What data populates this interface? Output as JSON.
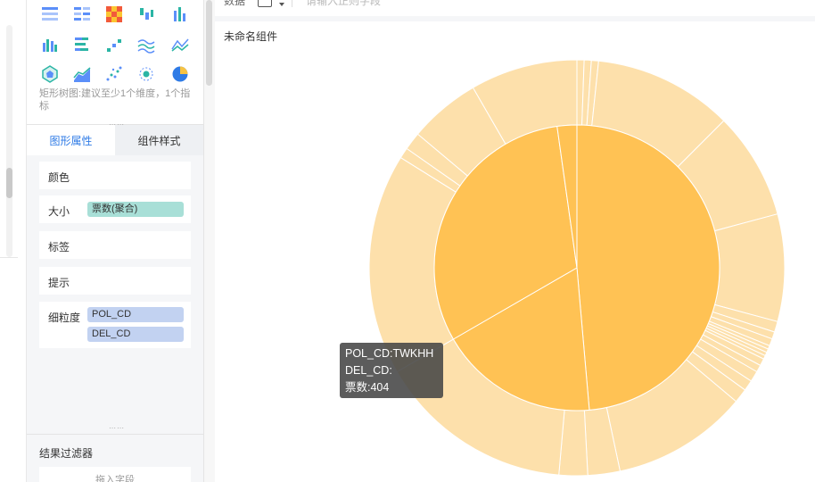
{
  "panel": {
    "chart_hint": "矩形树图:建议至少1个维度，1个指标",
    "tabs": [
      {
        "label": "图形属性",
        "active": true
      },
      {
        "label": "组件样式",
        "active": false
      }
    ],
    "props": {
      "color_label": "颜色",
      "size_label": "大小",
      "size_field": "票数(聚合)",
      "tag_label": "标签",
      "tip_label": "提示",
      "detail_label": "细粒度",
      "detail_fields": [
        "POL_CD",
        "DEL_CD"
      ]
    },
    "filter": {
      "title": "结果过滤器",
      "placeholder": "拖入字段"
    }
  },
  "main": {
    "topbar": {
      "label": "数据",
      "search_placeholder": "请输入正则字段"
    },
    "widget_title": "未命名组件"
  },
  "tooltip": {
    "line1": "POL_CD:TWKHH",
    "line2": "DEL_CD:",
    "line3": "票数:404"
  },
  "colors": {
    "inner_ring": "#ffc254",
    "outer_ring": "#fde0ab",
    "accent": "#2f7be6",
    "teal_pill": "#a8dfd7",
    "blue_pill": "#c2d2f1"
  },
  "chart_data": {
    "type": "sunburst",
    "inner": [
      {
        "name": "",
        "start_deg": 0,
        "end_deg": 175
      },
      {
        "name": "TWKHH",
        "start_deg": 175,
        "end_deg": 240,
        "value": 404
      },
      {
        "name": "",
        "start_deg": 240,
        "end_deg": 352
      },
      {
        "name": "",
        "start_deg": 352,
        "end_deg": 360
      }
    ],
    "outer_boundaries_deg": [
      0,
      2,
      4,
      6,
      45,
      75,
      105,
      108,
      110,
      112,
      113,
      114,
      115,
      116,
      118,
      120,
      123,
      126,
      130,
      168,
      177,
      185,
      240,
      302,
      305,
      310,
      330,
      360
    ]
  }
}
